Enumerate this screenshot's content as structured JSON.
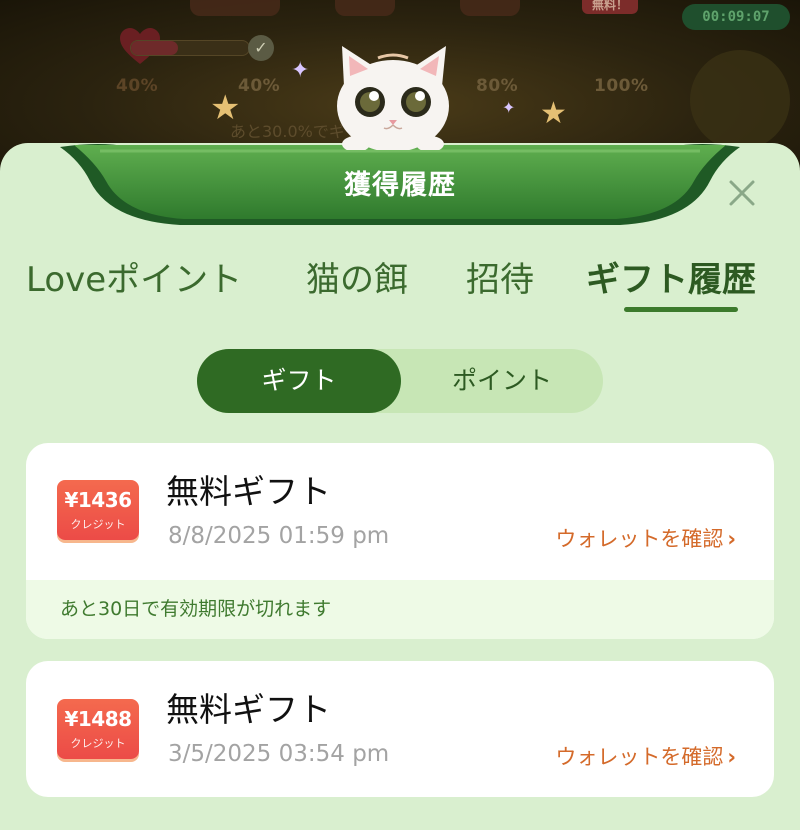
{
  "background": {
    "progress_labels": [
      "40%",
      "40%",
      "80%",
      "100%"
    ],
    "progress_fraction": 0.4,
    "timer": "00:09:07",
    "badge": "無料！",
    "hint": "あと30.0%でギフトをゲット"
  },
  "sheet": {
    "title": "獲得履歴",
    "close_icon": "close-icon"
  },
  "tabs": [
    {
      "label": "Loveポイント",
      "active": false
    },
    {
      "label": "猫の餌",
      "active": false
    },
    {
      "label": "招待",
      "active": false
    },
    {
      "label": "ギフト履歴",
      "active": true
    }
  ],
  "segmented": {
    "options": [
      "ギフト",
      "ポイント"
    ],
    "selected": "ギフト"
  },
  "gifts": [
    {
      "amount": "¥1436",
      "amount_sub": "クレジット",
      "title": "無料ギフト",
      "date": "8/8/2025 01:59 pm",
      "link": "ウォレットを確認",
      "expiry": "あと30日で有効期限が切れます"
    },
    {
      "amount": "¥1488",
      "amount_sub": "クレジット",
      "title": "無料ギフト",
      "date": "3/5/2025 03:54 pm",
      "link": "ウォレットを確認"
    }
  ],
  "colors": {
    "sheet_bg": "#d9efcf",
    "accent_green": "#2f6a23",
    "ribbon_green": "#3f8f3a",
    "link_orange": "#d46a2a",
    "coupon_red": "#ec4b47"
  }
}
